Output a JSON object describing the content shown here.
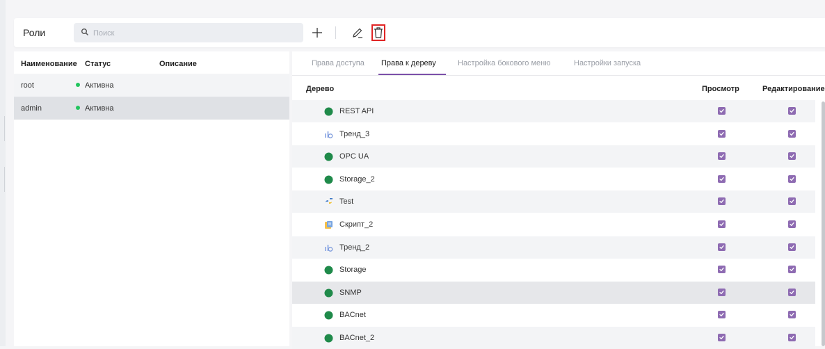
{
  "header": {
    "title": "Роли",
    "search_placeholder": "Поиск",
    "add_icon": "plus-icon",
    "edit_icon": "pencil-icon",
    "delete_icon": "trash-icon"
  },
  "roles": {
    "columns": [
      "Наименование",
      "Статус",
      "Описание"
    ],
    "rows": [
      {
        "name": "root",
        "status": "Активна",
        "description": ""
      },
      {
        "name": "admin",
        "status": "Активна",
        "description": ""
      }
    ],
    "selected": "admin"
  },
  "tabs": [
    {
      "label": "Права доступа",
      "active": false
    },
    {
      "label": "Права к дереву",
      "active": true
    },
    {
      "label": "Настройка бокового меню",
      "active": false
    },
    {
      "label": "Настройки запуска",
      "active": false
    }
  ],
  "tree": {
    "columns": {
      "tree": "Дерево",
      "view": "Просмотр",
      "edit": "Редактирование"
    },
    "rows": [
      {
        "name": "REST API",
        "icon": "green-node-icon",
        "view": true,
        "edit": true
      },
      {
        "name": "Тренд_3",
        "icon": "trend-icon",
        "view": true,
        "edit": true
      },
      {
        "name": "OPC UA",
        "icon": "green-node-icon",
        "view": true,
        "edit": true
      },
      {
        "name": "Storage_2",
        "icon": "green-node-icon",
        "view": true,
        "edit": true
      },
      {
        "name": "Test",
        "icon": "python-icon",
        "view": true,
        "edit": true
      },
      {
        "name": "Скрипт_2",
        "icon": "script-icon",
        "view": true,
        "edit": true
      },
      {
        "name": "Тренд_2",
        "icon": "trend-icon",
        "view": true,
        "edit": true
      },
      {
        "name": "Storage",
        "icon": "green-node-icon",
        "view": true,
        "edit": true
      },
      {
        "name": "SNMP",
        "icon": "green-node-icon",
        "view": true,
        "edit": true
      },
      {
        "name": "BACnet",
        "icon": "green-node-icon",
        "view": true,
        "edit": true
      },
      {
        "name": "BACnet_2",
        "icon": "green-node-icon",
        "view": true,
        "edit": true
      }
    ]
  },
  "colors": {
    "accent": "#7b4fa8",
    "checkbox": "#8e6bb2",
    "status_active": "#22c55e",
    "delete_highlight": "#e02424",
    "node_green": "#1f8a4a"
  }
}
